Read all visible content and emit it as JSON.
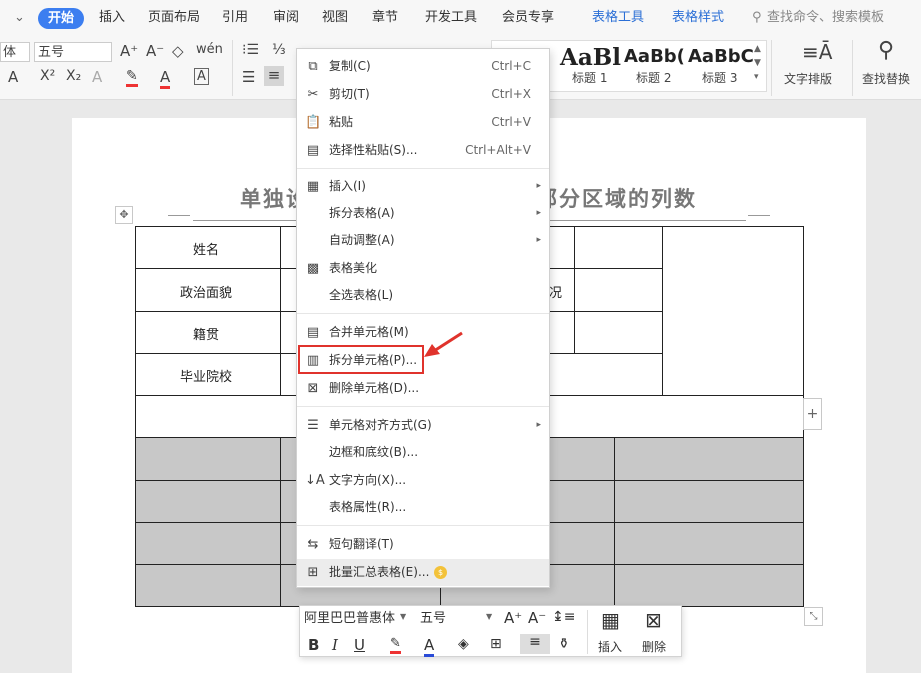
{
  "menubar": {
    "dropdown": "⌄",
    "tabs": [
      "开始",
      "插入",
      "页面布局",
      "引用",
      "审阅",
      "视图",
      "章节",
      "开发工具",
      "会员专享",
      "表格工具",
      "表格样式"
    ],
    "search": "查找命令、搜索模板"
  },
  "ribbon": {
    "font_name": "体",
    "font_size": "五号",
    "styles": [
      {
        "preview": "AaBl",
        "label": "标题 1"
      },
      {
        "preview": "AaBb(",
        "label": "标题 2"
      },
      {
        "preview": "AaBbC",
        "label": "标题 3"
      }
    ],
    "text_layout": "文字排版",
    "find_replace": "查找替换"
  },
  "document": {
    "title_left": "单独设",
    "title_right": "部分区域的列数",
    "rows": [
      "姓名",
      "政治面貌",
      "籍贯",
      "毕业院校"
    ],
    "partial_label": "况"
  },
  "context_menu": {
    "items": [
      {
        "icon": "copy-icon",
        "glyph": "⧉",
        "label": "复制(C)",
        "shortcut": "Ctrl+C"
      },
      {
        "icon": "cut-icon",
        "glyph": "✂",
        "label": "剪切(T)",
        "shortcut": "Ctrl+X"
      },
      {
        "icon": "paste-icon",
        "glyph": "📋",
        "label": "粘贴",
        "shortcut": "Ctrl+V"
      },
      {
        "icon": "paste-special-icon",
        "glyph": "▤",
        "label": "选择性粘贴(S)...",
        "shortcut": "Ctrl+Alt+V"
      },
      {
        "icon": "insert-table-icon",
        "glyph": "▦",
        "label": "插入(I)",
        "submenu": true
      },
      {
        "icon": "",
        "glyph": "",
        "label": "拆分表格(A)",
        "submenu": true
      },
      {
        "icon": "",
        "glyph": "",
        "label": "自动调整(A)",
        "submenu": true
      },
      {
        "icon": "table-beautify-icon",
        "glyph": "▩",
        "label": "表格美化"
      },
      {
        "icon": "",
        "glyph": "",
        "label": "全选表格(L)"
      },
      {
        "icon": "merge-cells-icon",
        "glyph": "▤",
        "label": "合并单元格(M)"
      },
      {
        "icon": "split-cells-icon",
        "glyph": "▥",
        "label": "拆分单元格(P)..."
      },
      {
        "icon": "delete-cells-icon",
        "glyph": "⊠",
        "label": "删除单元格(D)..."
      },
      {
        "icon": "cell-align-icon",
        "glyph": "☰",
        "label": "单元格对齐方式(G)",
        "submenu": true
      },
      {
        "icon": "",
        "glyph": "",
        "label": "边框和底纹(B)..."
      },
      {
        "icon": "text-direction-icon",
        "glyph": "↓A",
        "label": "文字方向(X)..."
      },
      {
        "icon": "",
        "glyph": "",
        "label": "表格属性(R)..."
      },
      {
        "icon": "translate-icon",
        "glyph": "⇆",
        "label": "短句翻译(T)"
      },
      {
        "icon": "batch-summary-icon",
        "glyph": "⊞",
        "label": "批量汇总表格(E)...",
        "badge": true
      }
    ]
  },
  "float_toolbar": {
    "font": "阿里巴巴普惠体",
    "size": "五号",
    "insert_label": "插入",
    "delete_label": "删除"
  },
  "colors": {
    "accent": "#3c7ef0",
    "highlight": "#e0332c",
    "table_tool": "#2b6fd6"
  }
}
